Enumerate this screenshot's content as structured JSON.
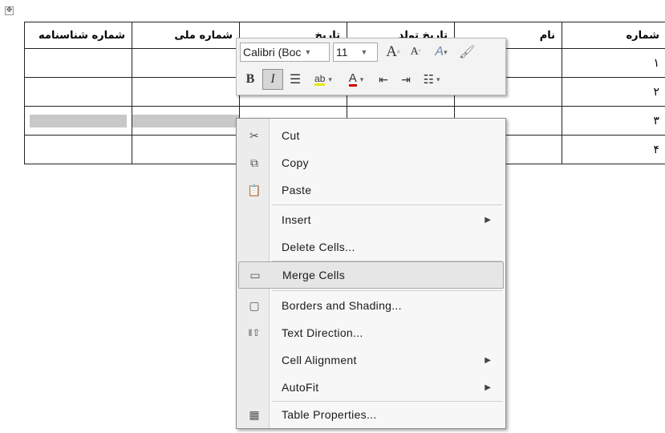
{
  "table": {
    "headers": [
      "شماره شناسنامه",
      "شماره ملی",
      "تاریخ",
      "تاریخ تولد",
      "نام",
      "شماره"
    ],
    "rows": [
      {
        "num": "۱"
      },
      {
        "num": "۲"
      },
      {
        "num": "۳"
      },
      {
        "num": "۴"
      }
    ]
  },
  "mini_toolbar": {
    "font_name": "Calibri (Boc",
    "font_size": "11",
    "grow_font": "A",
    "shrink_font": "A",
    "bold": "B",
    "italic": "I",
    "font_color_letter": "A",
    "highlight_text": "ab"
  },
  "context_menu": {
    "items": [
      {
        "label": "Cut",
        "icon": "scissors-icon"
      },
      {
        "label": "Copy",
        "icon": "copy-icon"
      },
      {
        "label": "Paste",
        "icon": "paste-icon"
      },
      {
        "label": "Insert",
        "icon": "",
        "submenu": true
      },
      {
        "label": "Delete Cells...",
        "icon": ""
      },
      {
        "label": "Merge Cells",
        "icon": "merge-cells-icon",
        "highlighted": true
      },
      {
        "label": "Borders and Shading...",
        "icon": "borders-icon"
      },
      {
        "label": "Text Direction...",
        "icon": "text-direction-icon"
      },
      {
        "label": "Cell Alignment",
        "icon": "",
        "submenu": true
      },
      {
        "label": "AutoFit",
        "icon": "",
        "submenu": true
      },
      {
        "label": "Table Properties...",
        "icon": "table-properties-icon"
      }
    ]
  },
  "colors": {
    "menu_bg": "#f7f7f7",
    "highlight": "#e6e6e6",
    "shaded_cells": "#c8c8c8"
  }
}
